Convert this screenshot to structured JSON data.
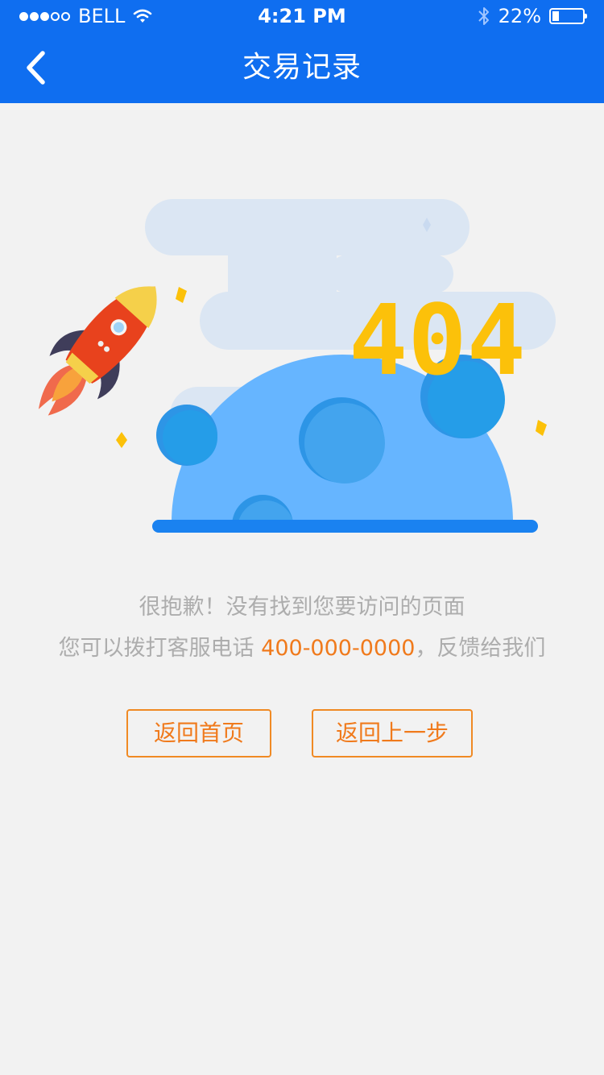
{
  "status_bar": {
    "carrier": "BELL",
    "time": "4:21 PM",
    "battery": "22%",
    "battery_level": 0.22,
    "signal_bars": 3,
    "signal_total": 5
  },
  "nav": {
    "title": "交易记录"
  },
  "illustration": {
    "code": "404"
  },
  "message": {
    "line1": "很抱歉！没有找到您要访问的页面",
    "line2_prefix": "您可以拨打客服电话 ",
    "phone": "400-000-0000",
    "line2_suffix": "，反馈给我们"
  },
  "actions": {
    "home_label": "返回首页",
    "back_label": "返回上一步"
  },
  "colors": {
    "header": "#0f6ef0",
    "accent": "#f07a1c",
    "planet": "#66b5ff",
    "code": "#fcc10a"
  }
}
